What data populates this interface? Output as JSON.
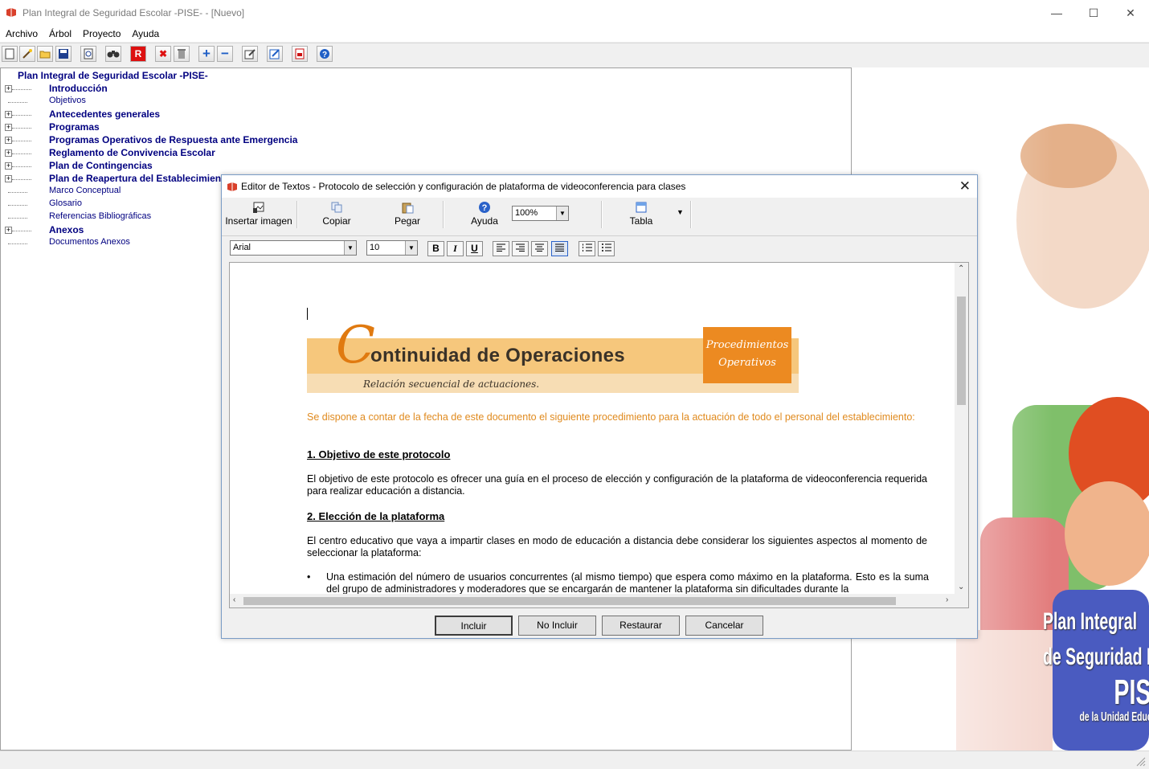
{
  "window": {
    "title": "Plan Integral de Seguridad Escolar -PISE- - [Nuevo]",
    "minimize": "—",
    "maximize": "☐",
    "close": "✕"
  },
  "menu": [
    "Archivo",
    "Árbol",
    "Proyecto",
    "Ayuda"
  ],
  "toolbar_icons": [
    "new-icon",
    "wizard-icon",
    "open-icon",
    "save-icon",
    "preview-icon",
    "find-icon",
    "r-icon",
    "delete-icon",
    "trash-icon",
    "add-icon",
    "remove-icon",
    "edit-icon",
    "text-edit-icon",
    "pdf-icon",
    "help-icon"
  ],
  "tree": {
    "root": "Plan Integral de Seguridad Escolar -PISE-",
    "items": [
      {
        "label": "Introducción",
        "bold": true,
        "expand": true
      },
      {
        "label": "Objetivos",
        "bold": false,
        "expand": false
      },
      {
        "label": "Antecedentes generales",
        "bold": true,
        "expand": true
      },
      {
        "label": "Programas",
        "bold": true,
        "expand": true
      },
      {
        "label": "Programas Operativos de Respuesta ante Emergencia",
        "bold": true,
        "expand": true
      },
      {
        "label": "Reglamento de Convivencia Escolar",
        "bold": true,
        "expand": true
      },
      {
        "label": "Plan de Contingencias",
        "bold": true,
        "expand": true
      },
      {
        "label": "Plan de Reapertura del Establecimien",
        "bold": true,
        "expand": true
      },
      {
        "label": "Marco Conceptual",
        "bold": false,
        "expand": false
      },
      {
        "label": "Glosario",
        "bold": false,
        "expand": false
      },
      {
        "label": "Referencias Bibliográficas",
        "bold": false,
        "expand": false
      },
      {
        "label": "Anexos",
        "bold": true,
        "expand": true
      },
      {
        "label": "Documentos Anexos",
        "bold": false,
        "expand": false
      }
    ]
  },
  "dialog": {
    "title": "Editor de Textos - Protocolo de selección y configuración de plataforma de videoconferencia para clases",
    "close": "✕",
    "toolbar": {
      "insert_image": "Insertar imagen",
      "copy": "Copiar",
      "paste": "Pegar",
      "help": "Ayuda",
      "zoom": "100%",
      "table": "Tabla"
    },
    "format": {
      "font": "Arial",
      "size": "10",
      "bold": "B",
      "italic": "I",
      "underline": "U"
    },
    "doc": {
      "banner_c": "C",
      "banner_title": "ontinuidad de Operaciones",
      "banner_subtitle": "Relación secuencial de actuaciones.",
      "banner_box_line1": "Procedimientos",
      "banner_box_line2": "Operativos",
      "intro": "Se dispone a contar de la fecha de este documento el siguiente procedimiento para la actuación de todo el personal del establecimiento:",
      "h1": "1. Objetivo de este protocolo",
      "p1": "El objetivo de este protocolo es ofrecer una guía en el proceso de elección y configuración de la plataforma de videoconferencia requerida para realizar educación a distancia.",
      "h2": "2. Elección de la plataforma",
      "p2": "El centro educativo que vaya a impartir clases en modo de educación a distancia debe considerar los siguientes aspectos al momento de seleccionar la plataforma:",
      "bullet1": "Una estimación del número de usuarios concurrentes (al mismo tiempo) que espera como máximo en la plataforma. Esto es la suma del grupo de administradores y moderadores que se encargarán de mantener la plataforma sin dificultades durante la"
    },
    "buttons": {
      "include": "Incluir",
      "not_include": "No Incluir",
      "restore": "Restaurar",
      "cancel": "Cancelar"
    }
  },
  "decor": {
    "line1": "Plan Integral",
    "line2": "de Seguridad Escolar",
    "line3": "PISE",
    "line4": "de la Unidad Educativa"
  }
}
